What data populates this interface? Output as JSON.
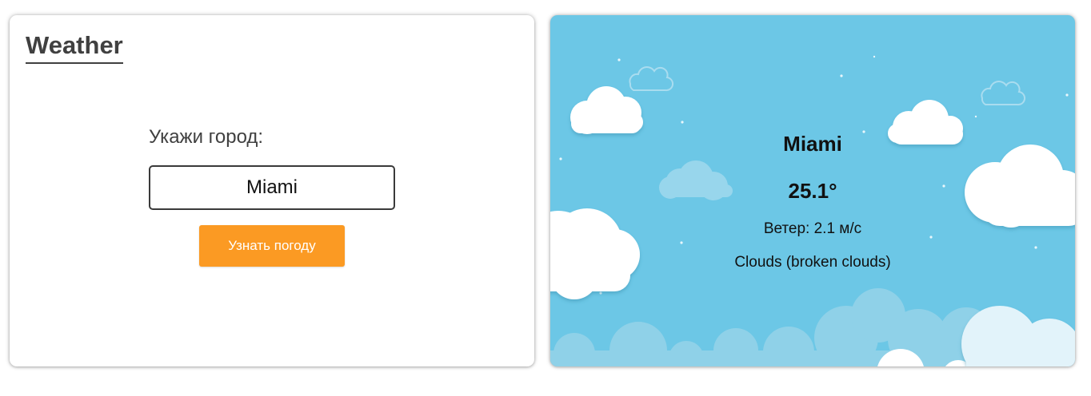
{
  "app": {
    "title": "Weather"
  },
  "form": {
    "label": "Укажи город:",
    "city_value": "Miami",
    "submit_label": "Узнать погоду"
  },
  "weather": {
    "city": "Miami",
    "temperature": "25.1°",
    "wind": "Ветер: 2.1 м/с",
    "description": "Clouds (broken clouds)"
  },
  "colors": {
    "accent_button": "#fb9a23",
    "sky": "#6cc7e6",
    "title_text": "#404040"
  }
}
